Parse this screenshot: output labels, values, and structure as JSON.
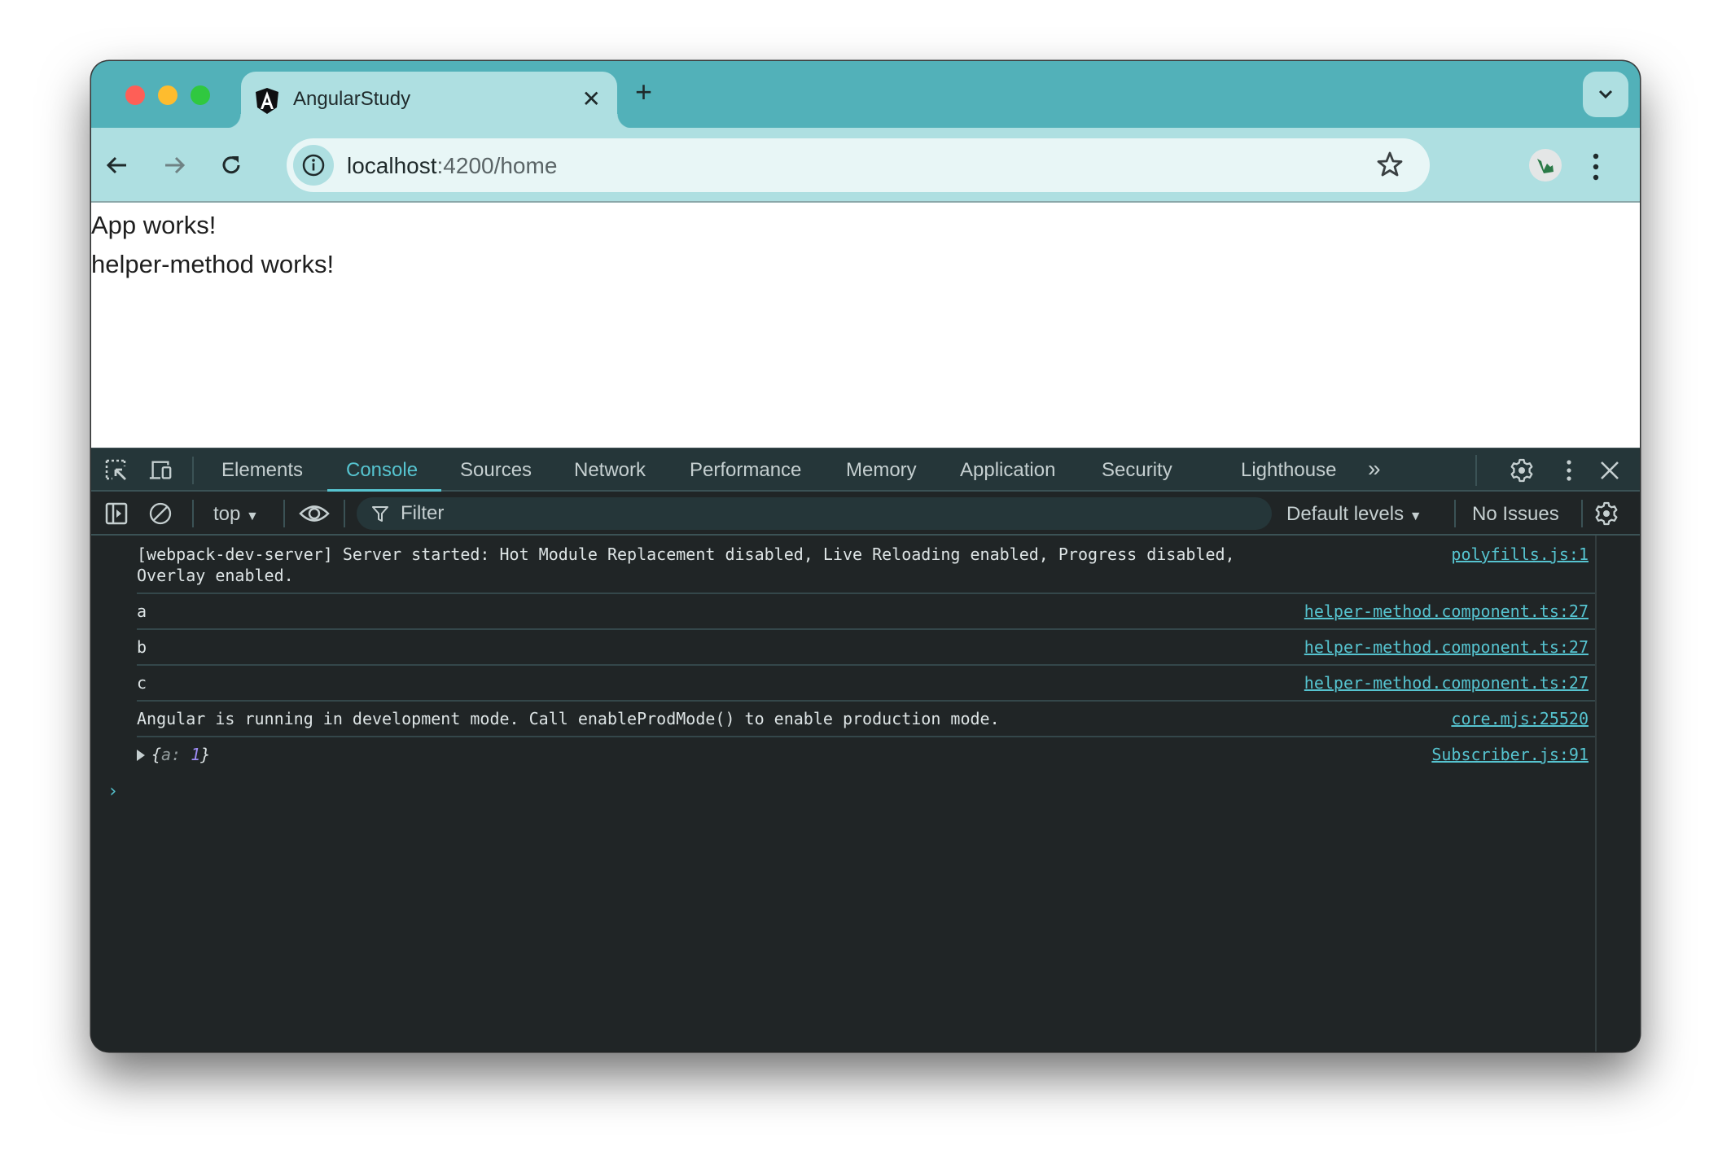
{
  "browser": {
    "tab": {
      "title": "AngularStudy",
      "favicon": "angular-logo-icon"
    },
    "new_tab_label": "+",
    "omnibox": {
      "host": "localhost",
      "rest": ":4200/home"
    }
  },
  "page": {
    "lines": [
      "App works!",
      "helper-method works!"
    ]
  },
  "devtools": {
    "tabs": [
      {
        "label": "Elements",
        "active": false
      },
      {
        "label": "Console",
        "active": true
      },
      {
        "label": "Sources",
        "active": false
      },
      {
        "label": "Network",
        "active": false
      },
      {
        "label": "Performance",
        "active": false
      },
      {
        "label": "Memory",
        "active": false
      },
      {
        "label": "Application",
        "active": false
      },
      {
        "label": "Security",
        "active": false
      },
      {
        "label": "Lighthouse",
        "active": false
      }
    ],
    "more_tabs_label": "»",
    "console_bar": {
      "context": "top",
      "filter_placeholder": "Filter",
      "levels": "Default levels",
      "issues": "No Issues"
    },
    "messages": [
      {
        "text": "[webpack-dev-server] Server started: Hot Module Replacement disabled, Live Reloading enabled, Progress disabled,\nOverlay enabled.",
        "source": "polyfills.js:1"
      },
      {
        "text": "a",
        "source": "helper-method.component.ts:27"
      },
      {
        "text": "b",
        "source": "helper-method.component.ts:27"
      },
      {
        "text": "c",
        "source": "helper-method.component.ts:27"
      },
      {
        "text": "Angular is running in development mode. Call enableProdMode() to enable production mode.",
        "source": "core.mjs:25520"
      },
      {
        "object": {
          "open": "{",
          "key": "a",
          "sep": ": ",
          "value": "1",
          "close": "}"
        },
        "source": "Subscriber.js:91"
      }
    ],
    "prompt": "›"
  },
  "colors": {
    "tabstrip": "#52b1b9",
    "toolbar": "#aedfe1",
    "devtools_accent": "#56c4d0",
    "console_bg": "#202526"
  }
}
